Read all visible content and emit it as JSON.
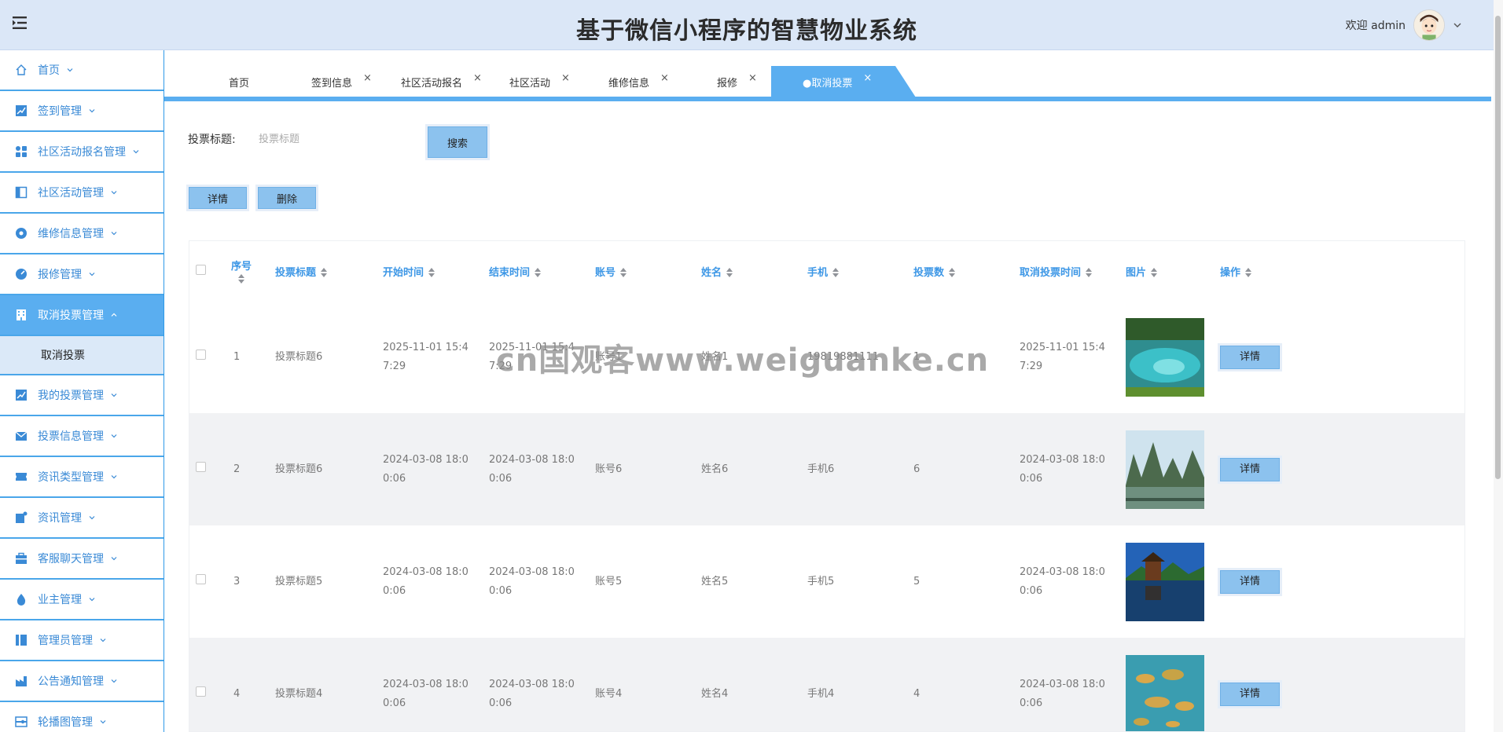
{
  "header": {
    "title": "基于微信小程序的智慧物业系统",
    "welcome": "欢迎 admin"
  },
  "sidebar": {
    "items": [
      {
        "label": "首页",
        "icon": "home-icon"
      },
      {
        "label": "签到管理",
        "icon": "chart-icon"
      },
      {
        "label": "社区活动报名管理",
        "icon": "grid-icon"
      },
      {
        "label": "社区活动管理",
        "icon": "panel-icon"
      },
      {
        "label": "维修信息管理",
        "icon": "circle-icon"
      },
      {
        "label": "报修管理",
        "icon": "gauge-icon"
      },
      {
        "label": "取消投票管理",
        "icon": "building-icon"
      },
      {
        "label": "我的投票管理",
        "icon": "chart-icon"
      },
      {
        "label": "投票信息管理",
        "icon": "mail-icon"
      },
      {
        "label": "资讯类型管理",
        "icon": "ticket-icon"
      },
      {
        "label": "资讯管理",
        "icon": "note-icon"
      },
      {
        "label": "客服聊天管理",
        "icon": "briefcase-icon"
      },
      {
        "label": "业主管理",
        "icon": "drop-icon"
      },
      {
        "label": "管理员管理",
        "icon": "columns-icon"
      },
      {
        "label": "公告通知管理",
        "icon": "factory-icon"
      },
      {
        "label": "轮播图管理",
        "icon": "slider-icon"
      }
    ],
    "sub_item": "取消投票"
  },
  "tabs": [
    {
      "label": "首页"
    },
    {
      "label": "签到信息"
    },
    {
      "label": "社区活动报名"
    },
    {
      "label": "社区活动"
    },
    {
      "label": "维修信息"
    },
    {
      "label": "报修"
    },
    {
      "label": "●取消投票"
    }
  ],
  "search": {
    "label": "投票标题:",
    "placeholder": "投票标题",
    "button": "搜索"
  },
  "actions": {
    "detail": "详情",
    "delete": "删除"
  },
  "table": {
    "columns": [
      "序号",
      "投票标题",
      "开始时间",
      "结束时间",
      "账号",
      "姓名",
      "手机",
      "投票数",
      "取消投票时间",
      "图片",
      "操作"
    ],
    "rows": [
      {
        "no": "1",
        "title": "投票标题6",
        "start": "2025-11-01 15:47:29",
        "end": "2025-11-01 15:47:29",
        "account": "账号1",
        "name": "姓名1",
        "phone": "19819881111",
        "votes": "1",
        "cancel_time": "2025-11-01 15:47:29",
        "image": "blue-lake",
        "op": "详情"
      },
      {
        "no": "2",
        "title": "投票标题6",
        "start": "2024-03-08 18:00:06",
        "end": "2024-03-08 18:00:06",
        "account": "账号6",
        "name": "姓名6",
        "phone": "手机6",
        "votes": "6",
        "cancel_time": "2024-03-08 18:00:06",
        "image": "karst-river",
        "op": "详情"
      },
      {
        "no": "3",
        "title": "投票标题5",
        "start": "2024-03-08 18:00:06",
        "end": "2024-03-08 18:00:06",
        "account": "账号5",
        "name": "姓名5",
        "phone": "手机5",
        "votes": "5",
        "cancel_time": "2024-03-08 18:00:06",
        "image": "pagoda-lake",
        "op": "详情"
      },
      {
        "no": "4",
        "title": "投票标题4",
        "start": "2024-03-08 18:00:06",
        "end": "2024-03-08 18:00:06",
        "account": "账号4",
        "name": "姓名4",
        "phone": "手机4",
        "votes": "4",
        "cancel_time": "2024-03-08 18:00:06",
        "image": "islands",
        "op": "详情"
      }
    ]
  },
  "watermark": "cn国观客www.weiguanke.cn",
  "colors": {
    "accent": "#5aaef0",
    "header_bg": "#dbe7f7",
    "link": "#3d97e6"
  }
}
